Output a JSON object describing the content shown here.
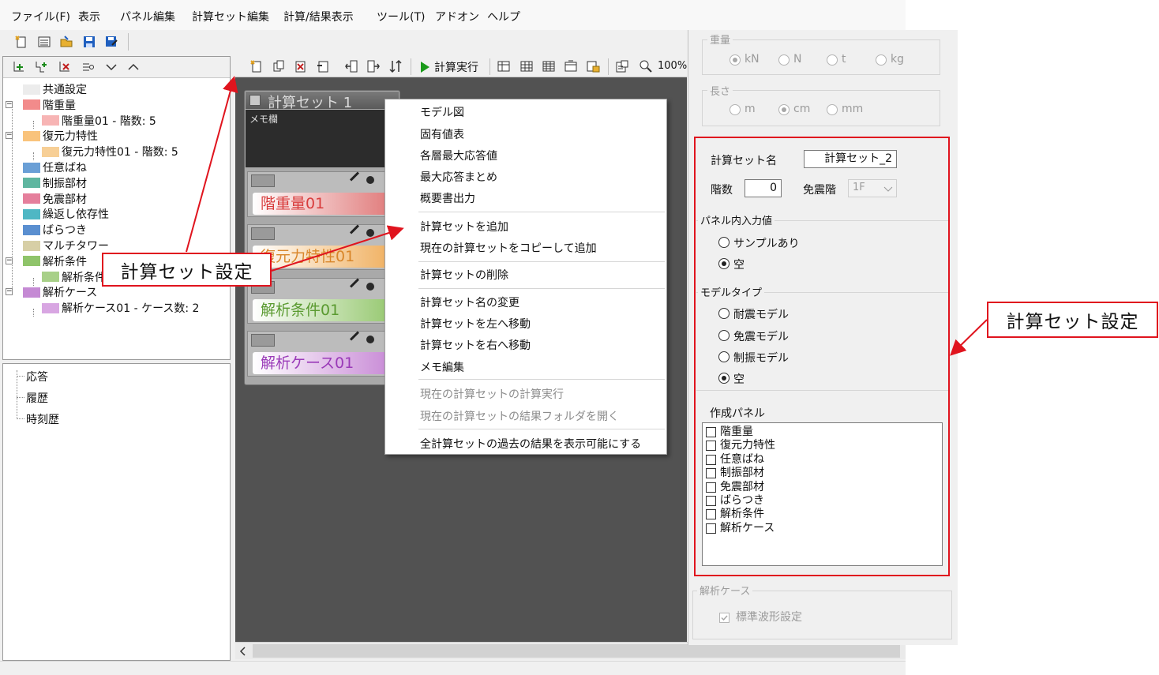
{
  "menu": [
    "ファイル(F)",
    "表示",
    "パネル編集",
    "計算セット編集",
    "計算/結果表示",
    "ツール(T)",
    "アドオン",
    "ヘルプ"
  ],
  "toolbar": {
    "run_label": "計算実行",
    "zoom": "100%"
  },
  "tree": {
    "items": [
      {
        "label": "共通設定",
        "color": "#ececec"
      },
      {
        "label": "階重量",
        "color": "#f28b8b"
      },
      {
        "label": "階重量01 - 階数: 5",
        "color": "#f7b4b4"
      },
      {
        "label": "復元力特性",
        "color": "#f9c37c"
      },
      {
        "label": "復元力特性01 - 階数: 5",
        "color": "#f7cf96"
      },
      {
        "label": "任意ばね",
        "color": "#6a9fd6"
      },
      {
        "label": "制振部材",
        "color": "#5fb6a0"
      },
      {
        "label": "免震部材",
        "color": "#e57f9c"
      },
      {
        "label": "繰返し依存性",
        "color": "#4fb7c4"
      },
      {
        "label": "ばらつき",
        "color": "#5a8fd0"
      },
      {
        "label": "マルチタワー",
        "color": "#d7cfa6"
      },
      {
        "label": "解析条件",
        "color": "#8fc46a"
      },
      {
        "label": "解析条件01",
        "color": "#a8d088"
      },
      {
        "label": "解析ケース",
        "color": "#c58ad4"
      },
      {
        "label": "解析ケース01 - ケース数: 2",
        "color": "#d8a6e2"
      }
    ]
  },
  "results": [
    "応答",
    "履歴",
    "時刻歴"
  ],
  "canvas": {
    "set_title": "計算セット 1",
    "memo_label": "メモ欄",
    "panels": [
      {
        "label": "階重量01",
        "color": "#e07a7a"
      },
      {
        "label": "復元力特性01",
        "color": "#f0b060"
      },
      {
        "label": "解析条件01",
        "color": "#96c870"
      },
      {
        "label": "解析ケース01",
        "color": "#c88ad6"
      }
    ]
  },
  "context_menu": {
    "groups": [
      [
        {
          "label": "モデル図"
        },
        {
          "label": "固有値表"
        },
        {
          "label": "各層最大応答値"
        },
        {
          "label": "最大応答まとめ"
        },
        {
          "label": "概要書出力"
        }
      ],
      [
        {
          "label": "計算セットを追加"
        },
        {
          "label": "現在の計算セットをコピーして追加"
        }
      ],
      [
        {
          "label": "計算セットの削除"
        }
      ],
      [
        {
          "label": "計算セット名の変更"
        },
        {
          "label": "計算セットを左へ移動"
        },
        {
          "label": "計算セットを右へ移動"
        },
        {
          "label": "メモ編集"
        }
      ],
      [
        {
          "label": "現在の計算セットの計算実行",
          "disabled": true
        },
        {
          "label": "現在の計算セットの結果フォルダを開く",
          "disabled": true
        }
      ],
      [
        {
          "label": "全計算セットの過去の結果を表示可能にする"
        }
      ]
    ]
  },
  "props": {
    "weight": {
      "title": "重量",
      "options": [
        "kN",
        "N",
        "t",
        "kg"
      ],
      "selected": 0
    },
    "length": {
      "title": "長さ",
      "options": [
        "m",
        "cm",
        "mm"
      ],
      "selected": 1
    },
    "set_name_label": "計算セット名",
    "set_name_value": "計算セット_2",
    "floors_label": "階数",
    "floors_value": "0",
    "isolation_floor_label": "免震階",
    "isolation_floor_value": "1F",
    "panel_input": {
      "title": "パネル内入力値",
      "options": [
        "サンプルあり",
        "空"
      ],
      "selected": 1
    },
    "model_type": {
      "title": "モデルタイプ",
      "options": [
        "耐震モデル",
        "免震モデル",
        "制振モデル",
        "空"
      ],
      "selected": 3
    },
    "create_panels": {
      "title": "作成パネル",
      "items": [
        "階重量",
        "復元力特性",
        "任意ばね",
        "制振部材",
        "免震部材",
        "ばらつき",
        "解析条件",
        "解析ケース"
      ]
    },
    "analysis_case": {
      "title": "解析ケース",
      "checkbox_label": "標準波形設定",
      "checked": true
    }
  },
  "annotations": {
    "left_callout": "計算セット設定",
    "right_callout": "計算セット設定",
    "color": "#e0141e"
  }
}
